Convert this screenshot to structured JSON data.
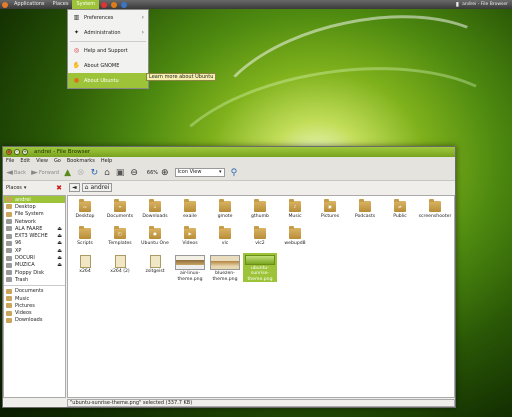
{
  "panel": {
    "applications": "Applications",
    "places": "Places",
    "system": "System",
    "window_title": "andrei - File Browser"
  },
  "system_menu": {
    "items": [
      "Preferences",
      "Administration",
      "Help and Support",
      "About GNOME",
      "About Ubuntu"
    ],
    "tooltip": "Learn more about Ubuntu"
  },
  "window": {
    "title": "andrei - File Browser"
  },
  "menubar": [
    "File",
    "Edit",
    "View",
    "Go",
    "Bookmarks",
    "Help"
  ],
  "toolbar": {
    "back": "Back",
    "forward": "Forward",
    "zoom": "66%",
    "view_mode": "Icon View"
  },
  "sidebar": {
    "header": "Places",
    "items": [
      "andrei",
      "Desktop",
      "File System",
      "Network",
      "ALA FAARE",
      "EXT3 WECHE",
      "96",
      "XP",
      "DOCURI",
      "MUZICA",
      "Floppy Disk",
      "Trash"
    ],
    "bookmarks": [
      "Documents",
      "Music",
      "Pictures",
      "Videos",
      "Downloads"
    ],
    "eject_items": [
      "ALA FAARE",
      "EXT3 WECHE",
      "96",
      "XP",
      "DOCURI",
      "MUZICA"
    ]
  },
  "path": {
    "current": "andrei"
  },
  "files": [
    {
      "name": "Desktop",
      "kind": "folder"
    },
    {
      "name": "Documents",
      "kind": "folder"
    },
    {
      "name": "Downloads",
      "kind": "folder"
    },
    {
      "name": "exaile",
      "kind": "folder"
    },
    {
      "name": "gmote",
      "kind": "folder"
    },
    {
      "name": "gthumb",
      "kind": "folder"
    },
    {
      "name": "Music",
      "kind": "folder"
    },
    {
      "name": "Pictures",
      "kind": "folder"
    },
    {
      "name": "Podcasts",
      "kind": "folder"
    },
    {
      "name": "Public",
      "kind": "folder"
    },
    {
      "name": "screenshooter",
      "kind": "folder"
    },
    {
      "name": "Scripts",
      "kind": "folder"
    },
    {
      "name": "Templates",
      "kind": "folder"
    },
    {
      "name": "Ubuntu One",
      "kind": "folder"
    },
    {
      "name": "Videos",
      "kind": "folder"
    },
    {
      "name": "vlc",
      "kind": "folder"
    },
    {
      "name": "vlc2",
      "kind": "folder"
    },
    {
      "name": "webupd8",
      "kind": "folder"
    },
    {
      "name": "x264",
      "kind": "file"
    },
    {
      "name": "x264 (2)",
      "kind": "file"
    },
    {
      "name": "zsitgeist",
      "kind": "file"
    },
    {
      "name": "air-linux-theme.png",
      "kind": "thumb"
    },
    {
      "name": "bluezen-theme.png",
      "kind": "thumb"
    },
    {
      "name": "ubuntu-sunrise-theme.png",
      "kind": "thumb"
    }
  ],
  "status": "\"ubuntu-sunrise-theme.png\" selected (337.7 KB)"
}
